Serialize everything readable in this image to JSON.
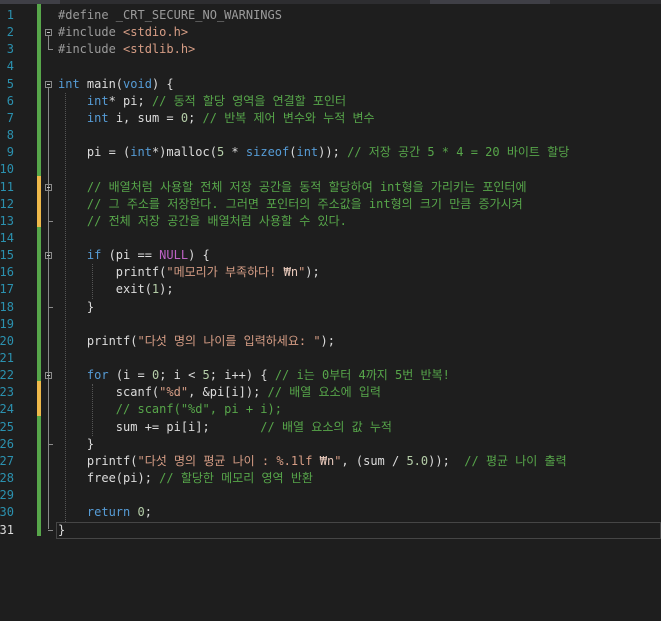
{
  "editor": {
    "current_line": 31,
    "lines": [
      {
        "n": "1",
        "tokens": [
          {
            "t": "#define _CRT_SECURE_NO_WARNINGS",
            "c": "pp"
          }
        ]
      },
      {
        "n": "2",
        "tokens": [
          {
            "t": "#include ",
            "c": "pp"
          },
          {
            "t": "<stdio.h>",
            "c": "str"
          }
        ]
      },
      {
        "n": "3",
        "tokens": [
          {
            "t": "#include ",
            "c": "pp"
          },
          {
            "t": "<stdlib.h>",
            "c": "str"
          }
        ]
      },
      {
        "n": "4",
        "tokens": []
      },
      {
        "n": "5",
        "tokens": [
          {
            "t": "int",
            "c": "kw"
          },
          {
            "t": " main(",
            "c": "plain"
          },
          {
            "t": "void",
            "c": "kw"
          },
          {
            "t": ") {",
            "c": "plain"
          }
        ]
      },
      {
        "n": "6",
        "tokens": [
          {
            "t": "    ",
            "c": "plain"
          },
          {
            "t": "int",
            "c": "kw"
          },
          {
            "t": "* pi; ",
            "c": "plain"
          },
          {
            "t": "// 동적 할당 영역을 연결할 포인터",
            "c": "cmt"
          }
        ]
      },
      {
        "n": "7",
        "tokens": [
          {
            "t": "    ",
            "c": "plain"
          },
          {
            "t": "int",
            "c": "kw"
          },
          {
            "t": " i, sum = ",
            "c": "plain"
          },
          {
            "t": "0",
            "c": "num"
          },
          {
            "t": "; ",
            "c": "plain"
          },
          {
            "t": "// 반복 제어 변수와 누적 변수",
            "c": "cmt"
          }
        ]
      },
      {
        "n": "8",
        "tokens": []
      },
      {
        "n": "9",
        "tokens": [
          {
            "t": "    pi = (",
            "c": "plain"
          },
          {
            "t": "int",
            "c": "kw"
          },
          {
            "t": "*)malloc(",
            "c": "plain"
          },
          {
            "t": "5",
            "c": "num"
          },
          {
            "t": " * ",
            "c": "plain"
          },
          {
            "t": "sizeof",
            "c": "kw"
          },
          {
            "t": "(",
            "c": "plain"
          },
          {
            "t": "int",
            "c": "kw"
          },
          {
            "t": ")); ",
            "c": "plain"
          },
          {
            "t": "// 저장 공간 5 * 4 = 20 바이트 할당",
            "c": "cmt"
          }
        ]
      },
      {
        "n": "10",
        "tokens": []
      },
      {
        "n": "11",
        "tokens": [
          {
            "t": "    ",
            "c": "plain"
          },
          {
            "t": "// 배열처럼 사용할 전체 저장 공간을 동적 할당하여 int형을 가리키는 포인터에",
            "c": "cmt"
          }
        ]
      },
      {
        "n": "12",
        "tokens": [
          {
            "t": "    ",
            "c": "plain"
          },
          {
            "t": "// 그 주소를 저장한다. 그러면 포인터의 주소값을 int형의 크기 만큼 증가시켜",
            "c": "cmt"
          }
        ]
      },
      {
        "n": "13",
        "tokens": [
          {
            "t": "    ",
            "c": "plain"
          },
          {
            "t": "// 전체 저장 공간을 배열처럼 사용할 수 있다.",
            "c": "cmt"
          }
        ]
      },
      {
        "n": "14",
        "tokens": []
      },
      {
        "n": "15",
        "tokens": [
          {
            "t": "    ",
            "c": "plain"
          },
          {
            "t": "if",
            "c": "kw"
          },
          {
            "t": " (pi == ",
            "c": "plain"
          },
          {
            "t": "NULL",
            "c": "mac"
          },
          {
            "t": ") {",
            "c": "plain"
          }
        ]
      },
      {
        "n": "16",
        "tokens": [
          {
            "t": "        printf(",
            "c": "plain"
          },
          {
            "t": "\"메모리가 부족하다! ",
            "c": "str"
          },
          {
            "t": "₩n",
            "c": "esc"
          },
          {
            "t": "\"",
            "c": "str"
          },
          {
            "t": ");",
            "c": "plain"
          }
        ]
      },
      {
        "n": "17",
        "tokens": [
          {
            "t": "        exit(",
            "c": "plain"
          },
          {
            "t": "1",
            "c": "num"
          },
          {
            "t": ");",
            "c": "plain"
          }
        ]
      },
      {
        "n": "18",
        "tokens": [
          {
            "t": "    }",
            "c": "plain"
          }
        ]
      },
      {
        "n": "19",
        "tokens": []
      },
      {
        "n": "20",
        "tokens": [
          {
            "t": "    printf(",
            "c": "plain"
          },
          {
            "t": "\"다섯 명의 나이를 입력하세요: \"",
            "c": "str"
          },
          {
            "t": ");",
            "c": "plain"
          }
        ]
      },
      {
        "n": "21",
        "tokens": []
      },
      {
        "n": "22",
        "tokens": [
          {
            "t": "    ",
            "c": "plain"
          },
          {
            "t": "for",
            "c": "kw"
          },
          {
            "t": " (i = ",
            "c": "plain"
          },
          {
            "t": "0",
            "c": "num"
          },
          {
            "t": "; i < ",
            "c": "plain"
          },
          {
            "t": "5",
            "c": "num"
          },
          {
            "t": "; i++) { ",
            "c": "plain"
          },
          {
            "t": "// i는 0부터 4까지 5번 반복!",
            "c": "cmt"
          }
        ]
      },
      {
        "n": "23",
        "tokens": [
          {
            "t": "        scanf(",
            "c": "plain"
          },
          {
            "t": "\"%d\"",
            "c": "str"
          },
          {
            "t": ", &pi[i]); ",
            "c": "plain"
          },
          {
            "t": "// 배열 요소에 입력",
            "c": "cmt"
          }
        ]
      },
      {
        "n": "24",
        "tokens": [
          {
            "t": "        ",
            "c": "plain"
          },
          {
            "t": "// scanf(\"%d\", pi + i);",
            "c": "cmt"
          }
        ]
      },
      {
        "n": "25",
        "tokens": [
          {
            "t": "        sum += pi[i];       ",
            "c": "plain"
          },
          {
            "t": "// 배열 요소의 값 누적",
            "c": "cmt"
          }
        ]
      },
      {
        "n": "26",
        "tokens": [
          {
            "t": "    }",
            "c": "plain"
          }
        ]
      },
      {
        "n": "27",
        "tokens": [
          {
            "t": "    printf(",
            "c": "plain"
          },
          {
            "t": "\"다섯 명의 평균 나이 : %.1lf ",
            "c": "str"
          },
          {
            "t": "₩n",
            "c": "esc"
          },
          {
            "t": "\"",
            "c": "str"
          },
          {
            "t": ", (sum / ",
            "c": "plain"
          },
          {
            "t": "5.0",
            "c": "num"
          },
          {
            "t": "));  ",
            "c": "plain"
          },
          {
            "t": "// 평균 나이 출력",
            "c": "cmt"
          }
        ]
      },
      {
        "n": "28",
        "tokens": [
          {
            "t": "    free(pi); ",
            "c": "plain"
          },
          {
            "t": "// 할당한 메모리 영역 반환",
            "c": "cmt"
          }
        ]
      },
      {
        "n": "29",
        "tokens": []
      },
      {
        "n": "30",
        "tokens": [
          {
            "t": "    ",
            "c": "plain"
          },
          {
            "t": "return",
            "c": "kw"
          },
          {
            "t": " ",
            "c": "plain"
          },
          {
            "t": "0",
            "c": "num"
          },
          {
            "t": ";",
            "c": "plain"
          }
        ]
      },
      {
        "n": "31",
        "tokens": [
          {
            "t": "}",
            "c": "plain"
          }
        ]
      }
    ]
  },
  "colors": {
    "background": "#1e1e1e",
    "line_number": "#2b91af",
    "keyword": "#569cd6",
    "comment": "#57a64a",
    "string": "#d69d85",
    "preprocessor": "#9b9b9b",
    "macro": "#bd63c5",
    "change_saved": "#57a64a",
    "change_unsaved": "#efb94a"
  }
}
